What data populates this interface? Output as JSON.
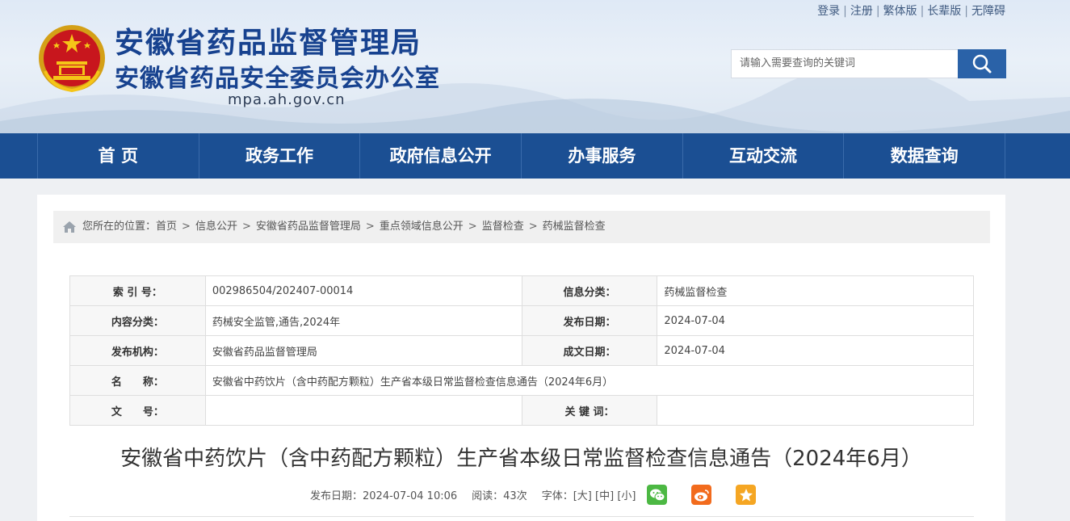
{
  "header": {
    "title_line1": "安徽省药品监督管理局",
    "title_line2": "安徽省药品安全委员会办公室",
    "domain": "mpa.ah.gov.cn",
    "toplinks": [
      "登录",
      "注册",
      "繁体版",
      "长辈版",
      "无障碍"
    ],
    "search_placeholder": "请输入需要查询的关键词"
  },
  "nav": {
    "items": [
      "首 页",
      "政务工作",
      "政府信息公开",
      "办事服务",
      "互动交流",
      "数据查询"
    ]
  },
  "breadcrumb": {
    "prefix": "您所在的位置：",
    "items": [
      "首页",
      "信息公开",
      "安徽省药品监督管理局",
      "重点领域信息公开",
      "监督检查",
      "药械监督检查"
    ],
    "separator": ">"
  },
  "info": {
    "index_label": "索 引 号：",
    "index_value": "002986504/202407-00014",
    "category_label": "信息分类：",
    "category_value": "药械监督检查",
    "content_label": "内容分类：",
    "content_value": "药械安全监管,通告,2024年",
    "pubdate_label": "发布日期：",
    "pubdate_value": "2024-07-04",
    "org_label": "发布机构：",
    "org_value": "安徽省药品监督管理局",
    "made_label": "成文日期：",
    "made_value": "2024-07-04",
    "name_label": "名　　称：",
    "name_value": "安徽省中药饮片（含中药配方颗粒）生产省本级日常监督检查信息通告（2024年6月）",
    "docno_label": "文　　号：",
    "docno_value": "",
    "keyword_label": "关 键 词：",
    "keyword_value": ""
  },
  "article": {
    "title": "安徽省中药饮片（含中药配方颗粒）生产省本级日常监督检查信息通告（2024年6月）",
    "pubdate": "发布日期：2024-07-04 10:06",
    "reads": "阅读：43次",
    "font_label": "字体：",
    "font_large": "[大]",
    "font_medium": "[中]",
    "font_small": "[小]"
  },
  "colors": {
    "nav_bg": "#1b4f93",
    "title_blue": "#17428f",
    "wechat": "#4cb843",
    "weibo": "#f26b1d",
    "favorite": "#f5a623"
  }
}
